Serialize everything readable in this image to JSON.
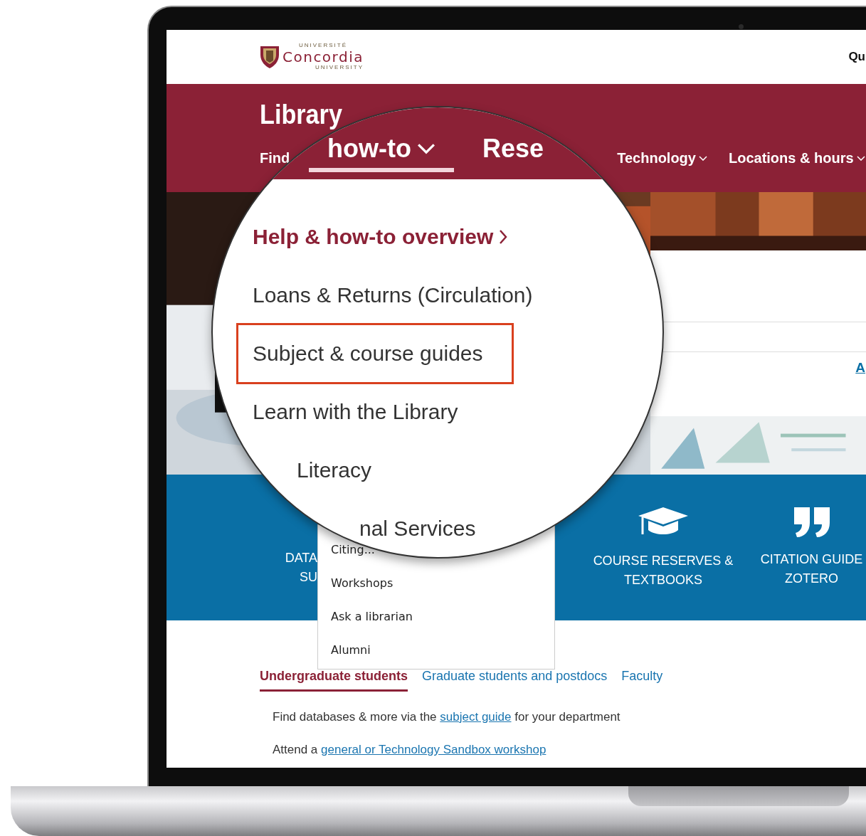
{
  "header": {
    "logo_top": "UNIVERSITÉ",
    "logo_name": "Concordia",
    "logo_bottom": "UNIVERSITY",
    "right_text": "Qu"
  },
  "banner": {
    "title": "Library",
    "nav": [
      {
        "label": "Find",
        "caret": false
      },
      {
        "label": "Technology",
        "caret": true
      },
      {
        "label": "Locations & hours",
        "caret": true
      }
    ]
  },
  "hero": {
    "link": "A"
  },
  "tiles": [
    {
      "kind": "cut",
      "lines": [
        "DATA",
        "SU"
      ]
    },
    {
      "kind": "cap",
      "lines": [
        "COURSE RESERVES &",
        "TEXTBOOKS"
      ]
    },
    {
      "kind": "quote",
      "lines": [
        "CITATION GUIDE",
        "ZOTERO"
      ]
    }
  ],
  "audience_tabs": [
    {
      "label": "Undergraduate students",
      "selected": true
    },
    {
      "label": "Graduate students and postdocs",
      "selected": false
    },
    {
      "label": "Faculty",
      "selected": false
    }
  ],
  "paragraphs": [
    {
      "before": "Find databases & more via the ",
      "link": "subject guide",
      "after": " for your department"
    },
    {
      "before": "Attend a ",
      "link": "general or Technology Sandbox workshop"
    }
  ],
  "dropdown": {
    "items": [
      "Citing...",
      "Workshops",
      "Ask a librarian",
      "Alumni"
    ]
  },
  "magnifier": {
    "nav": [
      {
        "label": "how-to",
        "selected": true
      },
      {
        "label": "Rese",
        "selected": false
      }
    ],
    "items": [
      {
        "label": "Help & how-to overview",
        "kind": "overview",
        "highlighted": false
      },
      {
        "label": "Loans & Returns (Circulation)",
        "kind": "link",
        "highlighted": false
      },
      {
        "label": "Subject & course guides",
        "kind": "link",
        "highlighted": true
      },
      {
        "label": "Learn with the Library",
        "kind": "link",
        "highlighted": false
      },
      {
        "label": "Literacy",
        "kind": "edge",
        "highlighted": false
      },
      {
        "label": "nal Services",
        "kind": "edge2",
        "highlighted": false
      }
    ]
  }
}
